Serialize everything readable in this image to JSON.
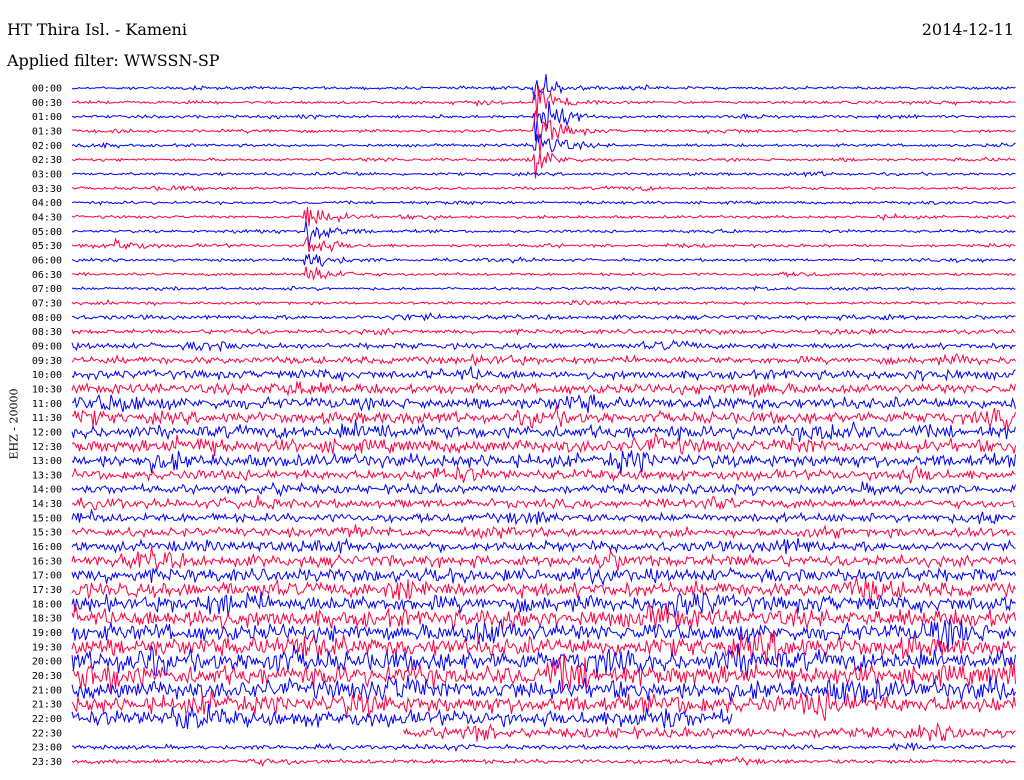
{
  "header": {
    "title": "HT Thira Isl. - Kameni",
    "date": "2014-12-11",
    "filter": "Applied filter: WWSSN-SP"
  },
  "chart_data": {
    "type": "line",
    "title": "HT Thira Isl. - Kameni",
    "date": "2014-12-11",
    "filter": "WWSSN-SP",
    "ylabel": "EHZ - 20000",
    "row_minutes": 30,
    "colors": [
      "#0000ff",
      "#ff0040"
    ],
    "rows": [
      "00:00",
      "00:30",
      "01:00",
      "01:30",
      "02:00",
      "02:30",
      "03:00",
      "03:30",
      "04:00",
      "04:30",
      "05:00",
      "05:30",
      "06:00",
      "06:30",
      "07:00",
      "07:30",
      "08:00",
      "08:30",
      "09:00",
      "09:30",
      "10:00",
      "10:30",
      "11:00",
      "11:30",
      "12:00",
      "12:30",
      "13:00",
      "13:30",
      "14:00",
      "14:30",
      "15:00",
      "15:30",
      "16:00",
      "16:30",
      "17:00",
      "17:30",
      "18:00",
      "18:30",
      "19:00",
      "19:30",
      "20:00",
      "20:30",
      "21:00",
      "21:30",
      "22:00",
      "22:30",
      "23:00",
      "23:30"
    ],
    "noise_amplitude": [
      2,
      2,
      2,
      2,
      2,
      2,
      2,
      2,
      2,
      2,
      2,
      2,
      2,
      2,
      2,
      2,
      3,
      3,
      4,
      5,
      6,
      7,
      8,
      8,
      9,
      9,
      9,
      7,
      6,
      6,
      6,
      6,
      7,
      8,
      9,
      10,
      11,
      12,
      12,
      13,
      14,
      14,
      13,
      12,
      11,
      7,
      3,
      3
    ],
    "events": [
      {
        "row": 2,
        "minute": 14.8,
        "amplitude": 42,
        "span_rows": [
          0,
          5
        ]
      },
      {
        "row": 10,
        "minute": 7.5,
        "amplitude": 30,
        "span_rows": [
          9,
          13
        ]
      },
      {
        "row": 11,
        "minute": 1.5,
        "amplitude": 10,
        "span_rows": [
          11,
          11
        ]
      }
    ],
    "data_gaps": [
      {
        "row": 44,
        "from_minute": 21.0,
        "to_minute": 30
      },
      {
        "row": 45,
        "from_minute": 0,
        "to_minute": 10.5
      }
    ]
  }
}
